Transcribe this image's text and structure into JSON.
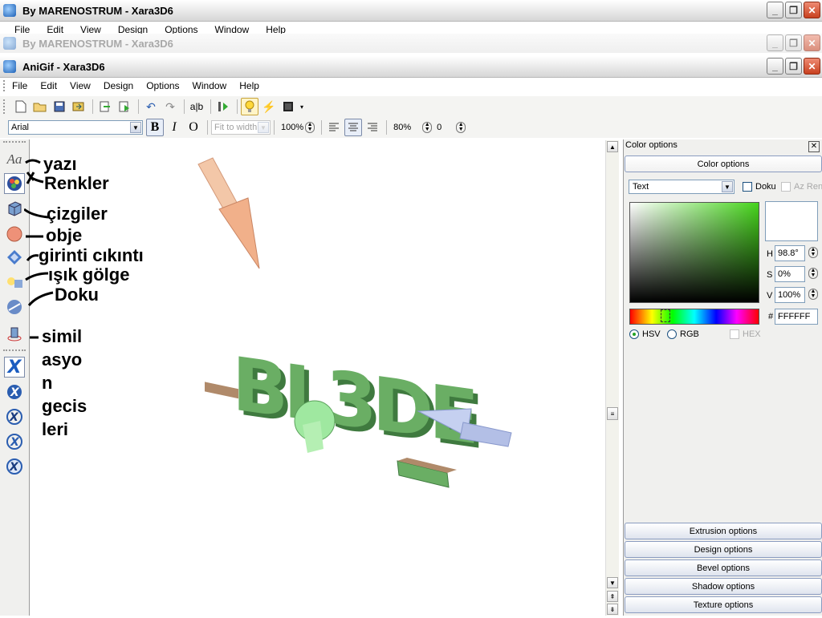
{
  "windows": {
    "back": {
      "title": "By MARENOSTRUM - Xara3D6",
      "menu": [
        "File",
        "Edit",
        "View",
        "Design",
        "Options",
        "Window",
        "Help"
      ]
    },
    "middle": {
      "title": "By MARENOSTRUM - Xara3D6"
    },
    "front": {
      "title": "AniGif - Xara3D6"
    }
  },
  "menu": [
    "File",
    "Edit",
    "View",
    "Design",
    "Options",
    "Window",
    "Help"
  ],
  "toolbar2": {
    "font": "Arial",
    "fit": "Fit to width",
    "zoom": "100%",
    "pct": "80%",
    "num": "0"
  },
  "lefttools": {
    "text_icon": "Aa"
  },
  "annotations": {
    "yazi": "yazı",
    "renkler": "Renkler",
    "cizgiler": "çizgiler",
    "obje": "obje",
    "girinti": "girinti cıkıntı",
    "isik": "ışık gölge",
    "doku": "Doku",
    "simil": [
      "simil",
      "asyo",
      "n",
      "gecis",
      "leri"
    ]
  },
  "panel": {
    "title": "Color options",
    "color_options": "Color options",
    "target": "Text",
    "doku": "Doku",
    "az_ren": "Az Ren",
    "h_label": "H",
    "h": "98.8°",
    "s_label": "S",
    "s": "0%",
    "v_label": "V",
    "v": "100%",
    "hash": "#",
    "hex": "FFFFFF",
    "hsv": "HSV",
    "rgb": "RGB",
    "hex_check": "HEX",
    "bars": [
      "Extrusion options",
      "Design options",
      "Bevel options",
      "Shadow options",
      "Texture options"
    ]
  },
  "canvas_text": "BL3DE",
  "colors": {
    "accent": "#3a7bd5",
    "letters": "#5a9e5a",
    "arrow1": "#f2b08a",
    "arrow2": "#aab8e6"
  }
}
